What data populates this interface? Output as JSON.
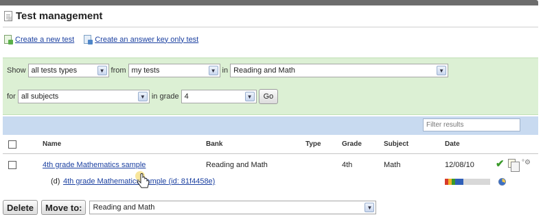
{
  "header": {
    "title": "Test management"
  },
  "actions": {
    "create_new": "Create a new test",
    "create_answer_key": "Create an answer key only test"
  },
  "filters": {
    "show_label": "Show",
    "test_type": "all tests types",
    "from_label": "from",
    "source": "my tests",
    "in_label": "in",
    "bank": "Reading and Math",
    "for_label": "for",
    "subject": "all subjects",
    "grade_label": "in grade",
    "grade": "4",
    "go_label": "Go"
  },
  "search": {
    "placeholder": "Filter results"
  },
  "table": {
    "columns": {
      "name": "Name",
      "bank": "Bank",
      "type": "Type",
      "grade": "Grade",
      "subject": "Subject",
      "date": "Date"
    },
    "rows": [
      {
        "name": "4th grade Mathematics sample",
        "bank": "Reading and Math",
        "type": "",
        "grade": "4th",
        "subject": "Math",
        "date": "12/08/10",
        "sub_prefix": "(d)",
        "sub_link": "4th grade Mathematics sample (id: 81f4458e)"
      }
    ]
  },
  "footer": {
    "delete_label": "Delete",
    "move_label": "Move to:",
    "destination": "Reading and Math"
  },
  "icons": {
    "title_icon": "document-icon",
    "create_icon": "new-test-icon",
    "answer_key_icon": "answer-key-icon",
    "status_icon": "check-icon",
    "copy_icon": "copy-icon",
    "settings_icon": "gear-icon",
    "chart_icon": "pie-chart-icon",
    "cursor": "hand-pointer-icon"
  },
  "colors": {
    "filter_panel": "#dcf0d4",
    "header_bar": "#c8daf0",
    "link": "#1a3fa0",
    "check": "#3a9a2a"
  }
}
